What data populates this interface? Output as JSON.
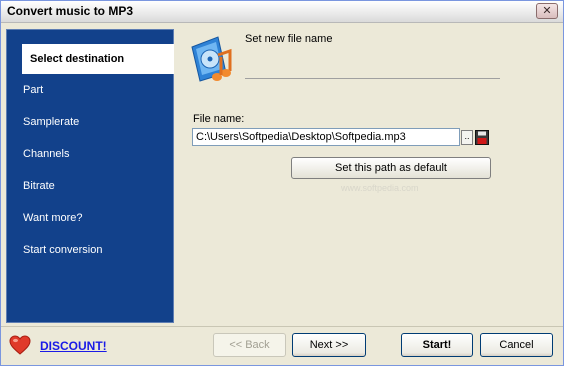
{
  "window": {
    "title": "Convert music to MP3",
    "close_label": "✕"
  },
  "sidebar": {
    "items": [
      {
        "label": "Select destination",
        "selected": true
      },
      {
        "label": "Part"
      },
      {
        "label": "Samplerate"
      },
      {
        "label": "Channels"
      },
      {
        "label": "Bitrate"
      },
      {
        "label": "Want more?"
      },
      {
        "label": "Start conversion"
      }
    ]
  },
  "header": {
    "label": "Set new file name",
    "icon": "music-cd-icon"
  },
  "form": {
    "file_label": "File name:",
    "file_value": "C:\\Users\\Softpedia\\Desktop\\Softpedia.mp3",
    "browse_label": "..",
    "save_icon": "floppy-disk-icon",
    "default_button": "Set this path as default"
  },
  "watermark": "www.softpedia.com",
  "footer": {
    "discount_label": "DISCOUNT!",
    "heart_icon": "heart-icon",
    "back_label": "<< Back",
    "next_label": "Next >>",
    "start_label": "Start!",
    "cancel_label": "Cancel"
  },
  "colors": {
    "sidebar_bg": "#12418B",
    "link": "#1A1AE6",
    "window_bg": "#ECE9D8"
  }
}
